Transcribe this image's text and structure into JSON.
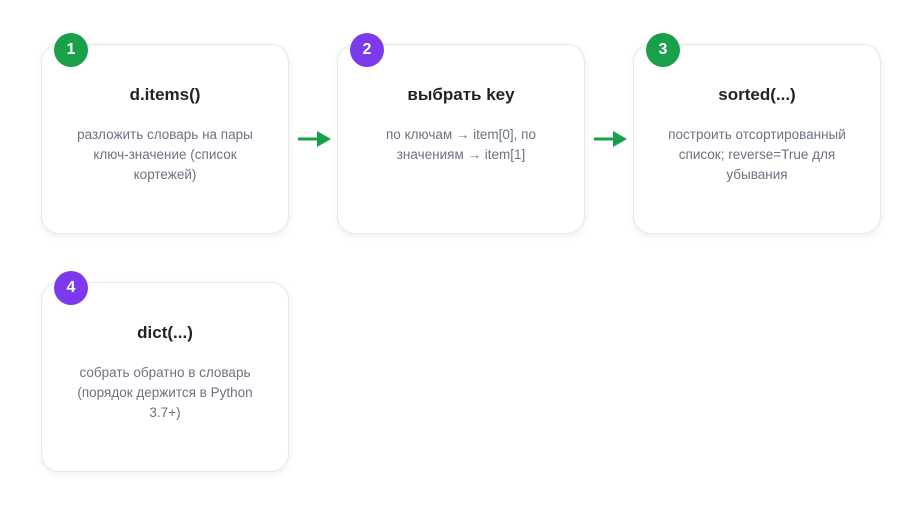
{
  "accent_colors": {
    "green": "#18a04a",
    "purple": "#7c3aed",
    "arrow": "#18a04a"
  },
  "steps": [
    {
      "number": "1",
      "title": "d.items()",
      "description": "разложить словарь на пары ключ-значение (список кортежей)",
      "badge_color": "#18a04a"
    },
    {
      "number": "2",
      "title": "выбрать key",
      "description": "по ключам → item[0], по значениям → item[1]",
      "badge_color": "#7c3aed"
    },
    {
      "number": "3",
      "title": "sorted(...)",
      "description": "построить отсортированный список; reverse=True для убывания",
      "badge_color": "#18a04a"
    },
    {
      "number": "4",
      "title": "dict(...)",
      "description": "собрать обратно в словарь (порядок держится в Python 3.7+)",
      "badge_color": "#7c3aed"
    }
  ],
  "arrows": [
    {
      "from": "1",
      "to": "2"
    },
    {
      "from": "2",
      "to": "3"
    }
  ]
}
